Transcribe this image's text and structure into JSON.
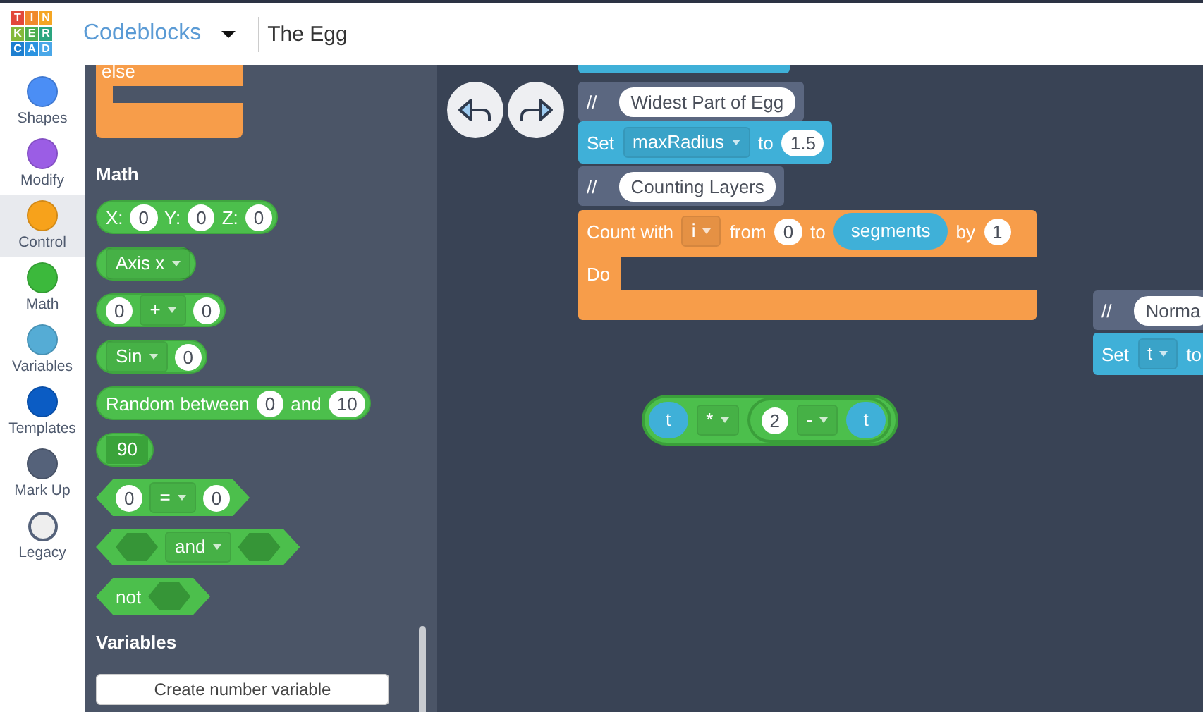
{
  "header": {
    "logo": [
      {
        "letter": "T",
        "color": "#e2483a"
      },
      {
        "letter": "I",
        "color": "#f08a2c"
      },
      {
        "letter": "N",
        "color": "#f5a623"
      },
      {
        "letter": "K",
        "color": "#84b93a"
      },
      {
        "letter": "E",
        "color": "#4cae4f"
      },
      {
        "letter": "R",
        "color": "#2aa57f"
      },
      {
        "letter": "C",
        "color": "#1e7fd0"
      },
      {
        "letter": "A",
        "color": "#2b93e0"
      },
      {
        "letter": "D",
        "color": "#49a7e8"
      }
    ],
    "mode": "Codeblocks",
    "title": "The Egg"
  },
  "categories": [
    {
      "label": "Shapes",
      "color": "#4b8ef5",
      "selected": false
    },
    {
      "label": "Modify",
      "color": "#9b5de5",
      "selected": false
    },
    {
      "label": "Control",
      "color": "#f7a21b",
      "selected": true
    },
    {
      "label": "Math",
      "color": "#3cb93c",
      "selected": false
    },
    {
      "label": "Variables",
      "color": "#55acd5",
      "selected": false
    },
    {
      "label": "Templates",
      "color": "#0b5cc4",
      "selected": false
    },
    {
      "label": "Mark Up",
      "color": "#55627a",
      "selected": false
    },
    {
      "label": "Legacy",
      "color": "#eeeeee",
      "selected": false
    }
  ],
  "palette": {
    "top_block": "else",
    "sections": [
      {
        "heading": "Math",
        "blocks": [
          {
            "kind": "round",
            "parts": [
              {
                "kind": "label",
                "text": "X:"
              },
              {
                "kind": "number",
                "text": "0"
              },
              {
                "kind": "label",
                "text": "Y:"
              },
              {
                "kind": "number",
                "text": "0"
              },
              {
                "kind": "label",
                "text": "Z:"
              },
              {
                "kind": "number",
                "text": "0"
              }
            ]
          },
          {
            "kind": "round",
            "parts": [
              {
                "kind": "dropdown",
                "text": "Axis x"
              }
            ]
          },
          {
            "kind": "round",
            "parts": [
              {
                "kind": "number",
                "text": "0"
              },
              {
                "kind": "dropdown",
                "text": "+"
              },
              {
                "kind": "number",
                "text": "0"
              }
            ]
          },
          {
            "kind": "round",
            "parts": [
              {
                "kind": "dropdown",
                "text": "Sin"
              },
              {
                "kind": "number",
                "text": "0"
              }
            ]
          },
          {
            "kind": "round",
            "parts": [
              {
                "kind": "label",
                "text": "Random between"
              },
              {
                "kind": "number",
                "text": "0"
              },
              {
                "kind": "label",
                "text": "and"
              },
              {
                "kind": "number",
                "text": "10"
              }
            ]
          },
          {
            "kind": "round",
            "parts": [
              {
                "kind": "field",
                "text": "90"
              }
            ]
          },
          {
            "kind": "hex",
            "parts": [
              {
                "kind": "number",
                "text": "0"
              },
              {
                "kind": "dropdown",
                "text": "="
              },
              {
                "kind": "number",
                "text": "0"
              }
            ]
          },
          {
            "kind": "hex",
            "parts": [
              {
                "kind": "slot"
              },
              {
                "kind": "dropdown",
                "text": "and"
              },
              {
                "kind": "slot"
              }
            ]
          },
          {
            "kind": "hex",
            "parts": [
              {
                "kind": "label",
                "text": "not"
              },
              {
                "kind": "slot"
              }
            ]
          }
        ]
      },
      {
        "heading": "Variables",
        "button": "Create number variable"
      }
    ]
  },
  "canvas": {
    "buttons": [
      {
        "kind": "undo"
      },
      {
        "kind": "redo"
      }
    ],
    "blocks": [
      {
        "kind": "stub"
      },
      {
        "kind": "comment",
        "parts": [
          {
            "kind": "label",
            "text": "//"
          },
          {
            "kind": "comment",
            "text": "Widest Part of Egg"
          }
        ]
      },
      {
        "kind": "set",
        "parts": [
          {
            "kind": "label",
            "text": "Set"
          },
          {
            "kind": "dropdown",
            "text": "maxRadius"
          },
          {
            "kind": "label",
            "text": "to"
          },
          {
            "kind": "number",
            "text": "1.5"
          }
        ]
      },
      {
        "kind": "comment",
        "parts": [
          {
            "kind": "label",
            "text": "//"
          },
          {
            "kind": "comment",
            "text": "Counting Layers"
          }
        ]
      },
      {
        "kind": "loop",
        "body_label": "Do",
        "parts": [
          {
            "kind": "label",
            "text": "Count with"
          },
          {
            "kind": "dropdown",
            "text": "i"
          },
          {
            "kind": "label",
            "text": "from"
          },
          {
            "kind": "number",
            "text": "0"
          },
          {
            "kind": "label",
            "text": "to"
          },
          {
            "kind": "variable",
            "text": "segments"
          },
          {
            "kind": "label",
            "text": "by"
          },
          {
            "kind": "number",
            "text": "1"
          }
        ]
      },
      {
        "kind": "comment",
        "parts": [
          {
            "kind": "label",
            "text": "//"
          },
          {
            "kind": "comment",
            "text": "Norma"
          }
        ]
      },
      {
        "kind": "set",
        "parts": [
          {
            "kind": "label",
            "text": "Set"
          },
          {
            "kind": "dropdown",
            "text": "t"
          },
          {
            "kind": "label",
            "text": "to"
          }
        ]
      },
      {
        "kind": "math",
        "parts": [
          {
            "kind": "variable",
            "text": "t"
          },
          {
            "kind": "dropdown",
            "text": "*"
          },
          {
            "kind": "group",
            "parts": [
              {
                "kind": "number",
                "text": "2"
              },
              {
                "kind": "dropdown",
                "text": "-"
              },
              {
                "kind": "variable",
                "text": "t"
              }
            ]
          }
        ]
      }
    ]
  }
}
